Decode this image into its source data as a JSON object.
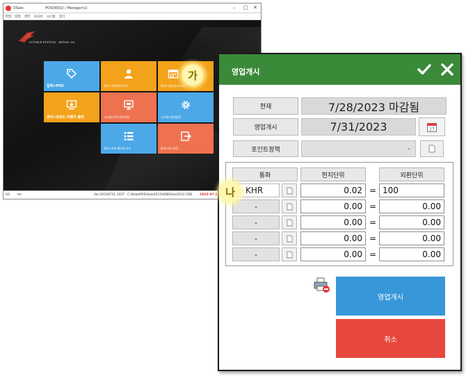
{
  "background_app": {
    "title": "DSale - POS(0001) / Manager(1)",
    "title_left": "DSale",
    "title_right": "POS(0001) / Manager(1)",
    "menu": [
      "파일",
      "입력",
      "관리",
      "보고서",
      "시스템",
      "창기"
    ],
    "logo_text": "DOUBLE EDITION · RETAIL Ver",
    "tiles": [
      {
        "label": "입력>POS",
        "color": "#4da8e8"
      },
      {
        "label": "관리>거래처관리(2)",
        "color": "#f3a21b"
      },
      {
        "label": "관리>영업개시(마감)",
        "color": "#f3a21b"
      },
      {
        "label": "관리>바코드 라벨지 출력",
        "color": "#f3a21b"
      },
      {
        "label": "시스템>A/S 원격지원",
        "color": "#ef7250"
      },
      {
        "label": "시스템>환경설정",
        "color": "#4da8e8"
      },
      {
        "label": "관리>기초 메뉴얼 보기",
        "color": "#4da8e8"
      },
      {
        "label": "관리>로그아웃",
        "color": "#ef7250"
      }
    ],
    "status": {
      "left1": "AS",
      "left2": "tel",
      "version": "Ver.20230731.1557",
      "path": "C:\\KebaPOS\\Sale2012\\KDB\\Sale2012.FDB",
      "date": "2023-07-28"
    }
  },
  "markers": {
    "ga": "가",
    "na": "나"
  },
  "dialog": {
    "title": "영업개시",
    "ok_icon": "check-icon",
    "close_icon": "close-icon",
    "current_label": "현재",
    "current_value": "7/28/2023 마감됨",
    "open_label": "영업개시",
    "open_value": "7/31/2023",
    "point_label": "포인트정책",
    "point_value": "",
    "headers": {
      "currency": "통화",
      "local": "현지단위",
      "exchange": "외환단위"
    },
    "rows": [
      {
        "currency": "KHR",
        "local": "0.02",
        "eq": "=",
        "exchange": "100"
      },
      {
        "currency": "-",
        "local": "0.00",
        "eq": "=",
        "exchange": "0.00"
      },
      {
        "currency": "-",
        "local": "0.00",
        "eq": "=",
        "exchange": "0.00"
      },
      {
        "currency": "-",
        "local": "0.00",
        "eq": "=",
        "exchange": "0.00"
      },
      {
        "currency": "-",
        "local": "0.00",
        "eq": "=",
        "exchange": "0.00"
      }
    ],
    "open_button": "영업개시",
    "cancel_button": "취소",
    "colors": {
      "header": "#3a8a3a",
      "open_button": "#3797d8",
      "cancel_button": "#e8473d"
    }
  }
}
